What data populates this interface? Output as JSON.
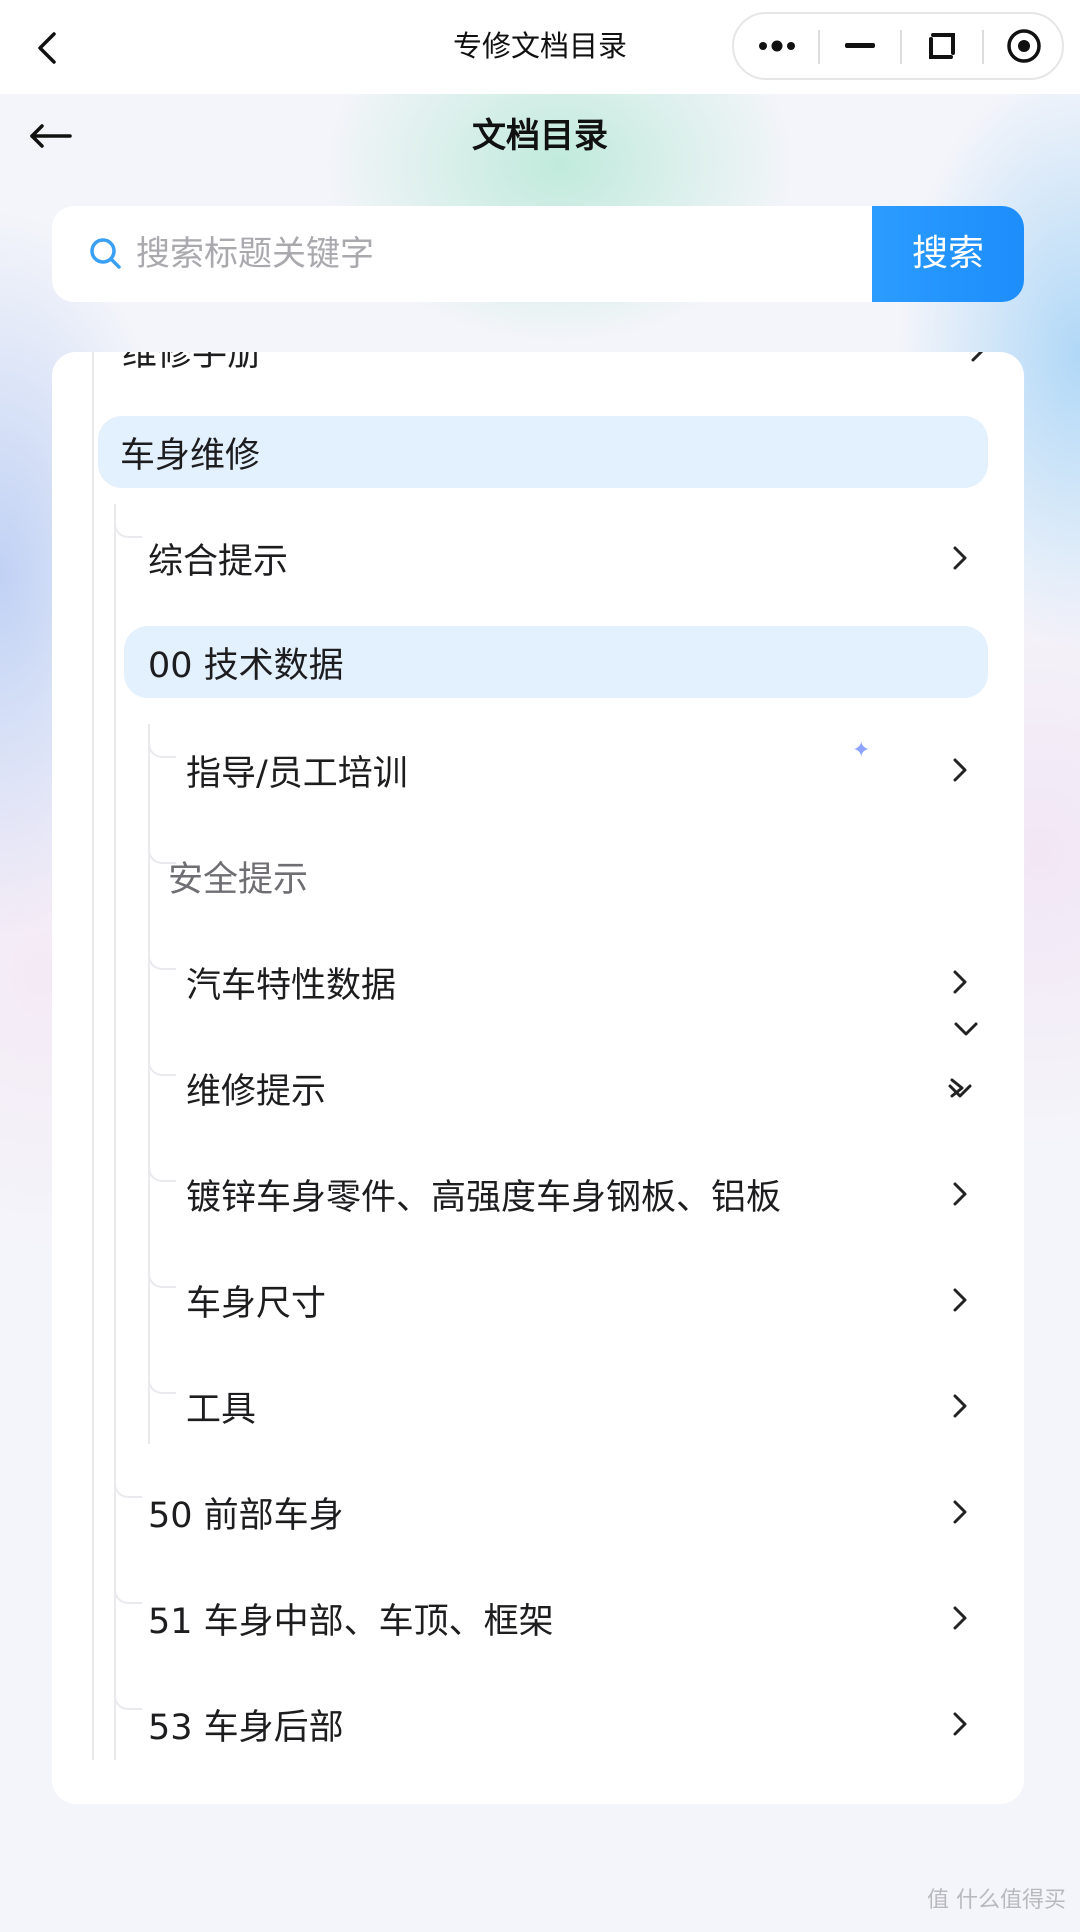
{
  "topbar": {
    "title": "专修文档目录",
    "capsule": [
      "more-icon",
      "minimize-icon",
      "restore-icon",
      "close-target-icon"
    ]
  },
  "header": {
    "title": "文档目录"
  },
  "search": {
    "placeholder": "搜索标题关键字",
    "value": "",
    "button_label": "搜索"
  },
  "tree": {
    "partial_item": "维修手册",
    "level1": {
      "label": "车身维修",
      "selected": true
    },
    "level2": [
      {
        "label": "综合提示"
      },
      {
        "label": "00 技术数据",
        "selected": true
      },
      {
        "label": "50 前部车身"
      },
      {
        "label": "51 车身中部、车顶、框架"
      },
      {
        "label": "53 车身后部"
      }
    ],
    "level3": [
      {
        "label": "指导/员工培训"
      },
      {
        "label": "安全提示"
      },
      {
        "label": "汽车特性数据"
      },
      {
        "label": "维修提示"
      },
      {
        "label": "镀锌车身零件、高强度车身钢板、铝板"
      },
      {
        "label": "车身尺寸"
      },
      {
        "label": "工具"
      }
    ]
  },
  "watermark": "值 什么值得买",
  "colors": {
    "accent": "#1d8dfb",
    "selected_bg": "#e3f0fd",
    "text": "#1d1d1f",
    "muted": "#6e6e73"
  }
}
